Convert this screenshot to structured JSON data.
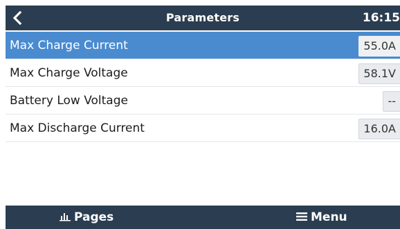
{
  "header": {
    "title": "Parameters",
    "time": "16:15",
    "back_icon": "chevron-left-icon"
  },
  "parameters": [
    {
      "label": "Max Charge Current",
      "value": "55.0A",
      "selected": true
    },
    {
      "label": "Max Charge Voltage",
      "value": "58.1V",
      "selected": false
    },
    {
      "label": "Battery Low Voltage",
      "value": "--",
      "selected": false
    },
    {
      "label": "Max Discharge Current",
      "value": "16.0A",
      "selected": false
    }
  ],
  "footer": {
    "pages_label": "Pages",
    "pages_icon": "bar-chart-icon",
    "menu_label": "Menu",
    "menu_icon": "hamburger-menu-icon"
  },
  "colors": {
    "header_bg": "#2b3d50",
    "selected_bg": "#4a8bd0"
  }
}
